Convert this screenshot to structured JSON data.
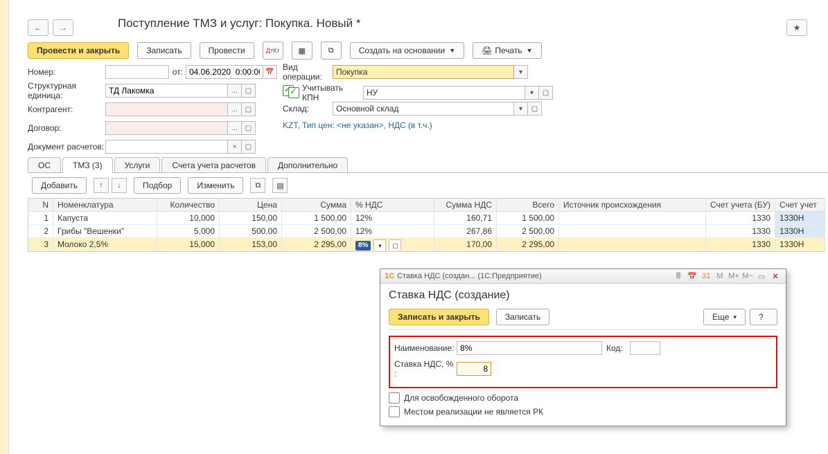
{
  "nav": {
    "back": "←",
    "fwd": "→",
    "star": "★"
  },
  "pageTitle": "Поступление ТМЗ и услуг: Покупка. Новый *",
  "toolbar1": {
    "postClose": "Провести и закрыть",
    "save": "Записать",
    "post": "Провести",
    "createBasis": "Создать на основании",
    "print": "Печать"
  },
  "form": {
    "numberLbl": "Номер:",
    "numberVal": "",
    "fromLbl": "от:",
    "dateVal": "04.06.2020  0:00:00",
    "opTypeLbl": "Вид операции:",
    "opTypeVal": "Покупка",
    "unitLbl": "Структурная единица:",
    "unitVal": "ТД Лакомка",
    "kpnLbl": "Учитывать КПН",
    "kpnVal": "НУ",
    "contragentLbl": "Контрагент:",
    "contragentVal": "",
    "warehouseLbl": "Склад:",
    "warehouseVal": "Основной склад",
    "contractLbl": "Договор:",
    "contractVal": "",
    "priceInfo": "KZT, Тип цен: <не указан>, НДС (в т.ч.)",
    "docLbl": "Документ расчетов:",
    "docVal": ""
  },
  "tabs": {
    "os": "ОС",
    "tmz": "ТМЗ (3)",
    "uslugi": "Услуги",
    "accounts": "Счета учета расчетов",
    "extra": "Дополнительно"
  },
  "toolbar2": {
    "add": "Добавить",
    "select": "Подбор",
    "change": "Изменить"
  },
  "table": {
    "headers": {
      "n": "N",
      "nom": "Номенклатура",
      "qty": "Количество",
      "price": "Цена",
      "sum": "Сумма",
      "vat": "% НДС",
      "vsum": "Сумма НДС",
      "total": "Всего",
      "src": "Источник происхождения",
      "acc": "Счет учета (БУ)",
      "acc2": "Счет учет"
    },
    "rows": [
      {
        "n": "1",
        "nom": "Капуста",
        "qty": "10,000",
        "price": "150,00",
        "sum": "1 500,00",
        "vat": "12%",
        "vsum": "160,71",
        "total": "1 500,00",
        "src": "",
        "acc": "1330",
        "acc2": "1330Н"
      },
      {
        "n": "2",
        "nom": "Грибы \"Вешенки\"",
        "qty": "5,000",
        "price": "500,00",
        "sum": "2 500,00",
        "vat": "12%",
        "vsum": "267,86",
        "total": "2 500,00",
        "src": "",
        "acc": "1330",
        "acc2": "1330Н"
      },
      {
        "n": "3",
        "nom": "Молоко 2,5%",
        "qty": "15,000",
        "price": "153,00",
        "sum": "2 295,00",
        "vat": "8%",
        "vsum": "170,00",
        "total": "2 295,00",
        "src": "",
        "acc": "1330",
        "acc2": "1330Н"
      }
    ]
  },
  "dialog": {
    "title": "Ставка НДС (создан...  (1С:Предприятие)",
    "header": "Ставка НДС (создание)",
    "saveClose": "Записать и закрыть",
    "save": "Записать",
    "more": "Еще",
    "help": "?",
    "nameLbl": "Наименование:",
    "nameVal": "8%",
    "codeLbl": "Код:",
    "codeVal": "",
    "rateLbl": "Ставка НДС, % :",
    "rateVal": "8",
    "chk1": "Для освобожденного оборота",
    "chk2": "Местом реализации не является РК",
    "m": "M",
    "mplus": "M+",
    "mminus": "M−"
  }
}
